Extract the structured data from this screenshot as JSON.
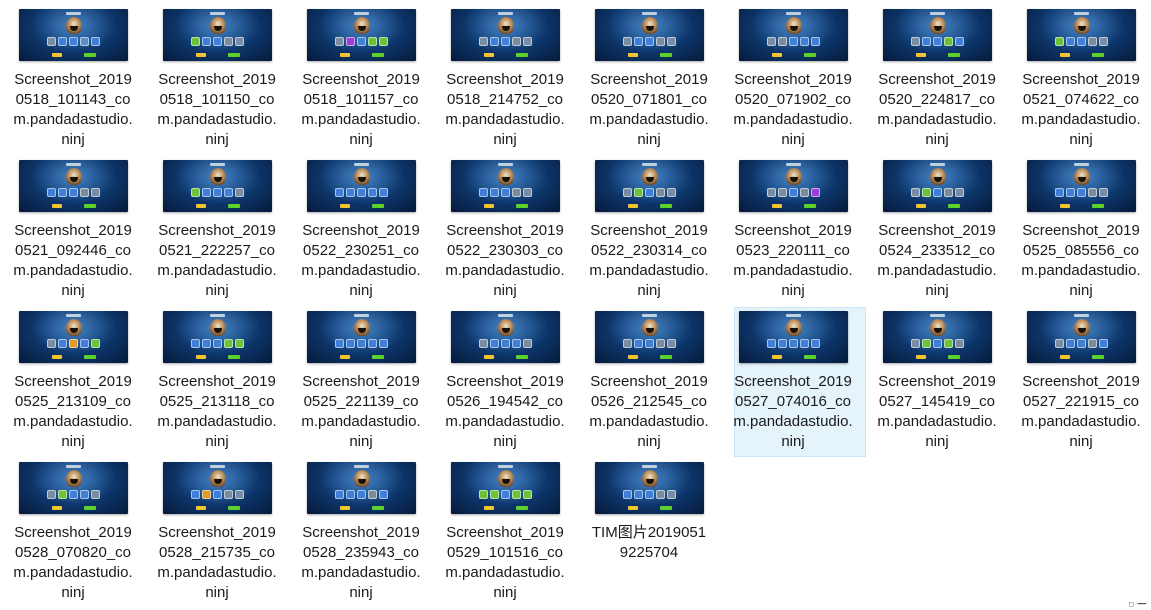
{
  "window": {
    "view": "large-icons",
    "corner_indicator": "□ ━━"
  },
  "accent_colors": {
    "selection_background": "#e5f3fb",
    "selection_border": "#cce8f8",
    "thumbnail_bg": "#0e3a72",
    "button_yellow": "#f4c431",
    "button_green": "#5fd12e"
  },
  "files": [
    {
      "name": "Screenshot_20190518_101143_com.pandadastudio.ninj",
      "selected": false,
      "icons": [
        "#7a8da0",
        "#3f7fd8",
        "#3f7fd8",
        "#5a8fc8",
        "#3f7fd8"
      ]
    },
    {
      "name": "Screenshot_20190518_101150_com.pandadastudio.ninj",
      "selected": false,
      "icons": [
        "#6cc23a",
        "#3f7fd8",
        "#3f7fd8",
        "#7a8da0",
        "#7a8da0"
      ]
    },
    {
      "name": "Screenshot_20190518_101157_com.pandadastudio.ninj",
      "selected": false,
      "icons": [
        "#7a8da0",
        "#9b3fd8",
        "#3f7fd8",
        "#6cc23a",
        "#6cc23a"
      ]
    },
    {
      "name": "Screenshot_20190518_214752_com.pandadastudio.ninj",
      "selected": false,
      "icons": [
        "#7a8da0",
        "#3f7fd8",
        "#3f7fd8",
        "#7a8da0",
        "#7a8da0"
      ]
    },
    {
      "name": "Screenshot_20190520_071801_com.pandadastudio.ninj",
      "selected": false,
      "icons": [
        "#7a8da0",
        "#3f7fd8",
        "#3f7fd8",
        "#7a8da0",
        "#7a8da0"
      ]
    },
    {
      "name": "Screenshot_20190520_071902_com.pandadastudio.ninj",
      "selected": false,
      "icons": [
        "#7a8da0",
        "#7a8da0",
        "#3f7fd8",
        "#3f7fd8",
        "#3f7fd8"
      ]
    },
    {
      "name": "Screenshot_20190520_224817_com.pandadastudio.ninj",
      "selected": false,
      "icons": [
        "#7a8da0",
        "#3f7fd8",
        "#3f7fd8",
        "#6cc23a",
        "#3f7fd8"
      ]
    },
    {
      "name": "Screenshot_20190521_074622_com.pandadastudio.ninj",
      "selected": false,
      "icons": [
        "#6cc23a",
        "#3f7fd8",
        "#3f7fd8",
        "#7a8da0",
        "#7a8da0"
      ]
    },
    {
      "name": "Screenshot_20190521_092446_com.pandadastudio.ninj",
      "selected": false,
      "icons": [
        "#3f7fd8",
        "#3f7fd8",
        "#3f7fd8",
        "#7a8da0",
        "#7a8da0"
      ]
    },
    {
      "name": "Screenshot_20190521_222257_com.pandadastudio.ninj",
      "selected": false,
      "icons": [
        "#6cc23a",
        "#3f7fd8",
        "#3f7fd8",
        "#3f7fd8",
        "#7a8da0"
      ]
    },
    {
      "name": "Screenshot_20190522_230251_com.pandadastudio.ninj",
      "selected": false,
      "icons": [
        "#3f7fd8",
        "#3f7fd8",
        "#3f7fd8",
        "#3f7fd8",
        "#3f7fd8"
      ]
    },
    {
      "name": "Screenshot_20190522_230303_com.pandadastudio.ninj",
      "selected": false,
      "icons": [
        "#3f7fd8",
        "#3f7fd8",
        "#3f7fd8",
        "#7a8da0",
        "#7a8da0"
      ]
    },
    {
      "name": "Screenshot_20190522_230314_com.pandadastudio.ninj",
      "selected": false,
      "icons": [
        "#7a8da0",
        "#6cc23a",
        "#3f7fd8",
        "#7a8da0",
        "#7a8da0"
      ]
    },
    {
      "name": "Screenshot_20190523_220111_com.pandadastudio.ninj",
      "selected": false,
      "icons": [
        "#7a8da0",
        "#7a8da0",
        "#3f7fd8",
        "#7a8da0",
        "#9b3fd8"
      ]
    },
    {
      "name": "Screenshot_20190524_233512_com.pandadastudio.ninj",
      "selected": false,
      "icons": [
        "#7a8da0",
        "#6cc23a",
        "#3f7fd8",
        "#7a8da0",
        "#7a8da0"
      ]
    },
    {
      "name": "Screenshot_20190525_085556_com.pandadastudio.ninj",
      "selected": false,
      "icons": [
        "#3f7fd8",
        "#3f7fd8",
        "#3f7fd8",
        "#7a8da0",
        "#7a8da0"
      ]
    },
    {
      "name": "Screenshot_20190525_213109_com.pandadastudio.ninj",
      "selected": false,
      "icons": [
        "#7a8da0",
        "#3f7fd8",
        "#e09a2a",
        "#3f7fd8",
        "#6cc23a"
      ]
    },
    {
      "name": "Screenshot_20190525_213118_com.pandadastudio.ninj",
      "selected": false,
      "icons": [
        "#3f7fd8",
        "#3f7fd8",
        "#3f7fd8",
        "#6cc23a",
        "#6cc23a"
      ]
    },
    {
      "name": "Screenshot_20190525_221139_com.pandadastudio.ninj",
      "selected": false,
      "icons": [
        "#3f7fd8",
        "#3f7fd8",
        "#3f7fd8",
        "#3f7fd8",
        "#3f7fd8"
      ]
    },
    {
      "name": "Screenshot_20190526_194542_com.pandadastudio.ninj",
      "selected": false,
      "icons": [
        "#7a8da0",
        "#3f7fd8",
        "#3f7fd8",
        "#3f7fd8",
        "#7a8da0"
      ]
    },
    {
      "name": "Screenshot_20190526_212545_com.pandadastudio.ninj",
      "selected": false,
      "icons": [
        "#7a8da0",
        "#3f7fd8",
        "#3f7fd8",
        "#7a8da0",
        "#7a8da0"
      ]
    },
    {
      "name": "Screenshot_20190527_074016_com.pandadastudio.ninj",
      "selected": true,
      "icons": [
        "#3f7fd8",
        "#3f7fd8",
        "#3f7fd8",
        "#3f7fd8",
        "#3f7fd8"
      ]
    },
    {
      "name": "Screenshot_20190527_145419_com.pandadastudio.ninj",
      "selected": false,
      "icons": [
        "#7a8da0",
        "#6cc23a",
        "#3f7fd8",
        "#6cc23a",
        "#7a8da0"
      ]
    },
    {
      "name": "Screenshot_20190527_221915_com.pandadastudio.ninj",
      "selected": false,
      "icons": [
        "#7a8da0",
        "#3f7fd8",
        "#3f7fd8",
        "#7a8da0",
        "#3f7fd8"
      ]
    },
    {
      "name": "Screenshot_20190528_070820_com.pandadastudio.ninj",
      "selected": false,
      "icons": [
        "#7a8da0",
        "#6cc23a",
        "#3f7fd8",
        "#3f7fd8",
        "#7a8da0"
      ]
    },
    {
      "name": "Screenshot_20190528_215735_com.pandadastudio.ninj",
      "selected": false,
      "icons": [
        "#3f7fd8",
        "#e09a2a",
        "#3f7fd8",
        "#7a8da0",
        "#7a8da0"
      ]
    },
    {
      "name": "Screenshot_20190528_235943_com.pandadastudio.ninj",
      "selected": false,
      "icons": [
        "#3f7fd8",
        "#3f7fd8",
        "#3f7fd8",
        "#7a8da0",
        "#3f7fd8"
      ]
    },
    {
      "name": "Screenshot_20190529_101516_com.pandadastudio.ninj",
      "selected": false,
      "icons": [
        "#6cc23a",
        "#6cc23a",
        "#3f7fd8",
        "#6cc23a",
        "#6cc23a"
      ]
    },
    {
      "name": "TIM图片20190519225704",
      "selected": false,
      "icons": [
        "#3f7fd8",
        "#3f7fd8",
        "#3f7fd8",
        "#7a8da0",
        "#7a8da0"
      ]
    }
  ]
}
